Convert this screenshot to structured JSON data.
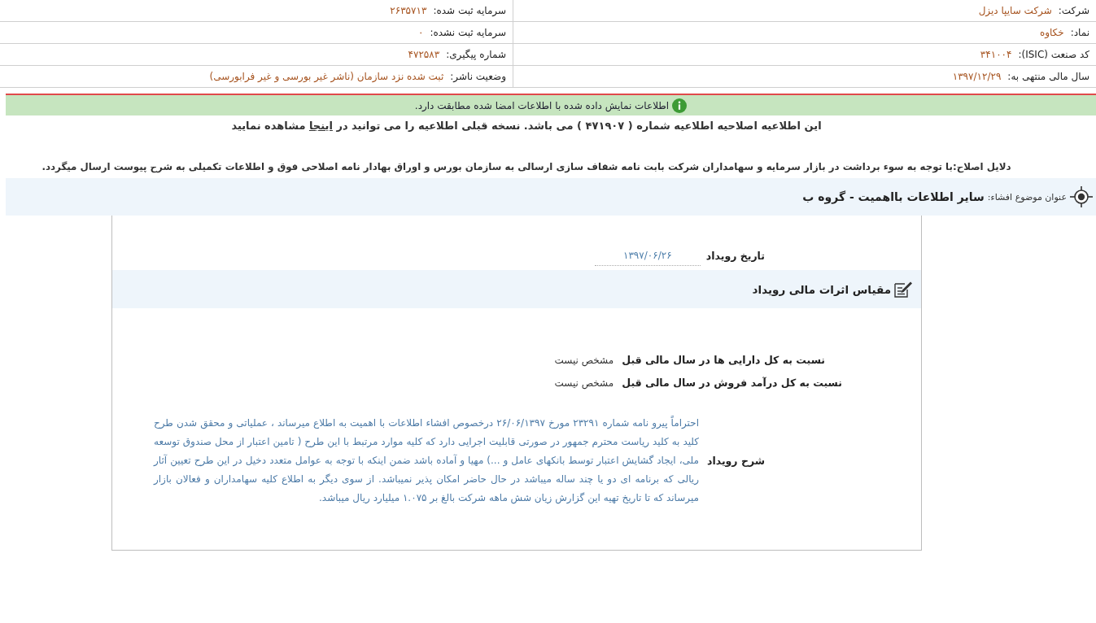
{
  "info_table": {
    "rows": [
      [
        {
          "label": "شرکت:",
          "value": "شرکت سایپا دیزل"
        },
        {
          "label": "سرمایه ثبت شده:",
          "value": "۲۶۳۵۷۱۳"
        }
      ],
      [
        {
          "label": "نماد:",
          "value": "خکاوه"
        },
        {
          "label": "سرمایه ثبت نشده:",
          "value": "۰"
        }
      ],
      [
        {
          "label": "کد صنعت (ISIC):",
          "value": "۳۴۱۰۰۴"
        },
        {
          "label": "شماره پیگیری:",
          "value": "۴۷۲۵۸۳"
        }
      ],
      [
        {
          "label": "سال مالی منتهی به:",
          "value": "۱۳۹۷/۱۲/۲۹"
        },
        {
          "label": "وضعیت ناشر:",
          "value": "ثبت شده نزد سازمان (ناشر غیر بورسی و غیر فرابورسی)"
        }
      ]
    ]
  },
  "verification_banner": {
    "text": "اطلاعات نمایش داده شده با اطلاعات امضا شده مطابقت دارد."
  },
  "correction_notice": {
    "before": "این اطلاعیه اصلاحیه اطلاعیه شماره ( ۴۷۱۹۰۷ ) می باشد. نسخه قبلی اطلاعیه را می توانید در",
    "link": "اینجا",
    "after": "مشاهده نمایید"
  },
  "correction_reasons": "دلایل اصلاح:با توجه به سوء برداشت در بازار سرمایه و سهامداران شرکت بابت نامه شفاف سازی ارسالی به سازمان بورس و اوراق بهادار نامه اصلاحی فوق و اطلاعات تکمیلی به شرح پیوست ارسال میگردد.",
  "subject": {
    "label": "عنوان موضوع افشاء:",
    "title": "سایر اطلاعات بااهمیت - گروه ب"
  },
  "event": {
    "date_label": "تاریخ رویداد",
    "date": "۱۳۹۷/۰۶/۲۶",
    "section_title": "مقیاس اثرات مالی رویداد",
    "metrics": [
      {
        "label": "نسبت به کل دارایی ها در سال مالی قبل",
        "value": "مشخص نیست"
      },
      {
        "label": "نسبت به کل درآمد فروش در سال مالی قبل",
        "value": "مشخص نیست"
      }
    ],
    "description_label": "شرح رویداد",
    "description": "احتراماً پیرو نامه شماره ۲۳۲۹۱ مورخ ۲۶/۰۶/۱۳۹۷ درخصوص افشاء اطلاعات با اهمیت به اطلاع میرساند ، عملیاتی و محقق شدن طرح کلید به کلید ریاست محترم جمهور در صورتی قابلیت اجرایی دارد که کلیه موارد مرتبط با این طرح ( تامین اعتبار از محل صندوق توسعه ملی، ایجاد گشایش اعتبار توسط بانکهای عامل و ...) مهیا و آماده باشد ضمن اینکه با توجه به عوامل متعدد دخیل در این طرح تعیین آثار ریالی که برنامه ای دو یا چند ساله میباشد در حال حاضر امکان پذیر نمیباشد. از سوی دیگر به اطلاع کلیه سهامداران و فعالان بازار میرساند که تا تاریخ تهیه این گزارش زیان شش ماهه شرکت بالغ بر ۱.۰۷۵ میلیارد ریال میباشد."
  }
}
